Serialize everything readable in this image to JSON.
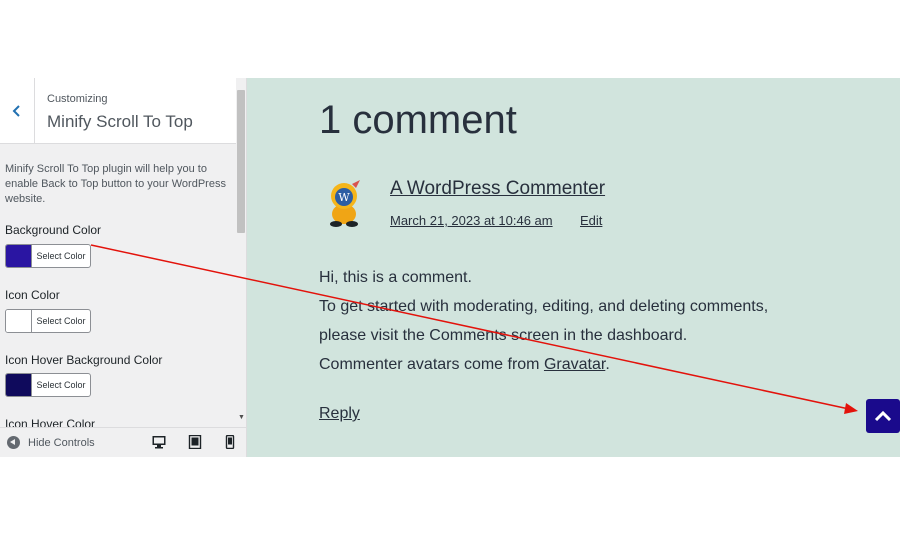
{
  "customizer": {
    "breadcrumb": "Customizing",
    "section_title": "Minify Scroll To Top",
    "description": "Minify Scroll To Top plugin will help you to enable Back to Top button to your WordPress website.",
    "controls": [
      {
        "label": "Background Color",
        "button": "Select Color",
        "color": "#2a15a2"
      },
      {
        "label": "Icon Color",
        "button": "Select Color",
        "color": "#ffffff"
      },
      {
        "label": "Icon Hover Background Color",
        "button": "Select Color",
        "color": "#0f0a5c"
      },
      {
        "label": "Icon Hover Color"
      }
    ],
    "footer": {
      "hide_controls": "Hide Controls",
      "devices": [
        "desktop-icon",
        "tablet-icon",
        "mobile-icon"
      ]
    }
  },
  "preview": {
    "comments_title": "1 comment",
    "author": "A WordPress Commenter",
    "date": "March 21, 2023 at 10:46 am",
    "edit": "Edit",
    "body": {
      "line1": "Hi, this is a comment.",
      "line2": "To get started with moderating, editing, and deleting comments,",
      "line3": "please visit the Comments screen in the dashboard.",
      "line4_prefix": "Commenter avatars come from ",
      "line4_link": "Gravatar",
      "line4_suffix": "."
    },
    "reply": "Reply",
    "scroll_top_color": "#1a0a8c"
  },
  "annotation": {
    "color": "#e3120b"
  }
}
